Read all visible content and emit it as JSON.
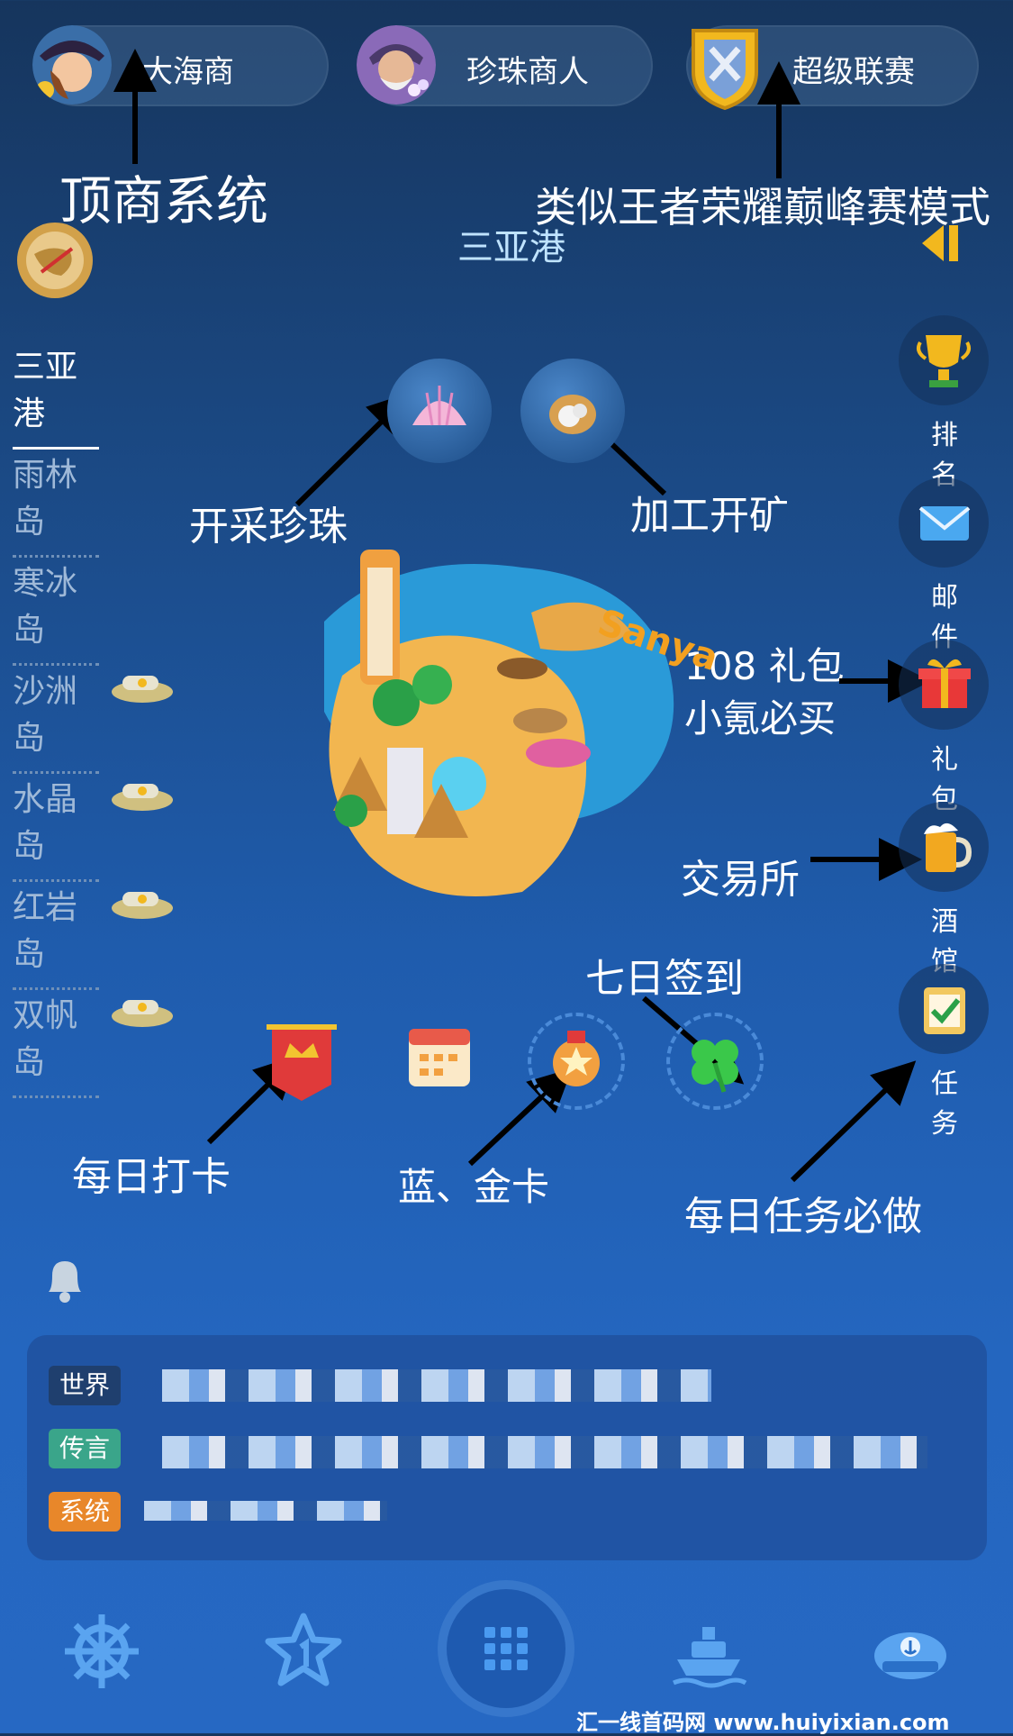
{
  "top_bar": {
    "items": [
      {
        "label": "大海商"
      },
      {
        "label": "珍珠商人"
      },
      {
        "label": "超级联赛"
      }
    ]
  },
  "port_title": "三亚港",
  "islands": [
    {
      "label": "三亚港",
      "active": true
    },
    {
      "label": "雨林岛"
    },
    {
      "label": "寒冰岛"
    },
    {
      "label": "沙洲岛"
    },
    {
      "label": "水晶岛"
    },
    {
      "label": "红岩岛"
    },
    {
      "label": "双帆岛"
    }
  ],
  "side_menu": [
    {
      "label": "排名",
      "icon": "trophy-icon"
    },
    {
      "label": "邮件",
      "icon": "mail-icon"
    },
    {
      "label": "礼包",
      "icon": "gift-icon"
    },
    {
      "label": "酒馆",
      "icon": "beer-icon"
    },
    {
      "label": "任务",
      "icon": "task-icon"
    }
  ],
  "island_map_label": "Sanya",
  "annotations": {
    "top_merchant": "顶商系统",
    "league": "类似王者荣耀巅峰赛模式",
    "pearl": "开采珍珠",
    "mining": "加工开矿",
    "gift_line1": "108 礼包",
    "gift_line2": "小氪必买",
    "exchange": "交易所",
    "checkin7": "七日签到",
    "daily_checkin": "每日打卡",
    "cards": "蓝、金卡",
    "daily_task": "每日任务必做"
  },
  "chat": {
    "tags": [
      {
        "label": "世界",
        "color": "#1f3f6e"
      },
      {
        "label": "传言",
        "color": "#3aa58a"
      },
      {
        "label": "系统",
        "color": "#e8872a"
      }
    ]
  },
  "footer_text": "汇一线首码网  www.huiyixian.com"
}
